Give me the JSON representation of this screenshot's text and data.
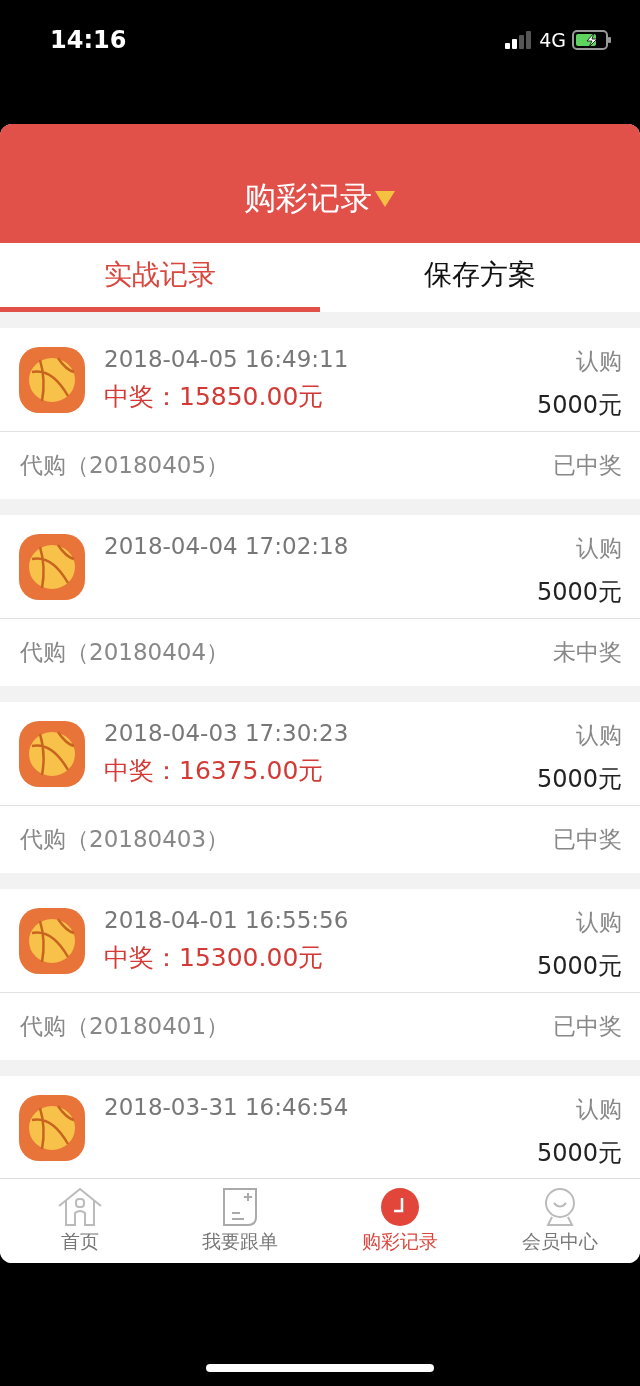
{
  "status_bar": {
    "time": "14:16",
    "network": "4G"
  },
  "header": {
    "title": "购彩记录"
  },
  "tabs": [
    {
      "label": "实战记录",
      "selected": true
    },
    {
      "label": "保存方案",
      "selected": false
    }
  ],
  "records": [
    {
      "time": "2018-04-05 16:49:11",
      "prize": "中奖：15850.00元",
      "label": "认购",
      "amount": "5000元",
      "order": "代购（20180405）",
      "status": "已中奖"
    },
    {
      "time": "2018-04-04 17:02:18",
      "label": "认购",
      "amount": "5000元",
      "order": "代购（20180404）",
      "status": "未中奖"
    },
    {
      "time": "2018-04-03 17:30:23",
      "prize": "中奖：16375.00元",
      "label": "认购",
      "amount": "5000元",
      "order": "代购（20180403）",
      "status": "已中奖"
    },
    {
      "time": "2018-04-01 16:55:56",
      "prize": "中奖：15300.00元",
      "label": "认购",
      "amount": "5000元",
      "order": "代购（20180401）",
      "status": "已中奖"
    },
    {
      "time": "2018-03-31 16:46:54",
      "label": "认购",
      "amount": "5000元"
    }
  ],
  "nav": [
    {
      "label": "首页",
      "kind": "home",
      "selected": false
    },
    {
      "label": "我要跟单",
      "kind": "follow",
      "selected": false
    },
    {
      "label": "购彩记录",
      "kind": "records",
      "selected": true
    },
    {
      "label": "会员中心",
      "kind": "member",
      "selected": false
    }
  ]
}
